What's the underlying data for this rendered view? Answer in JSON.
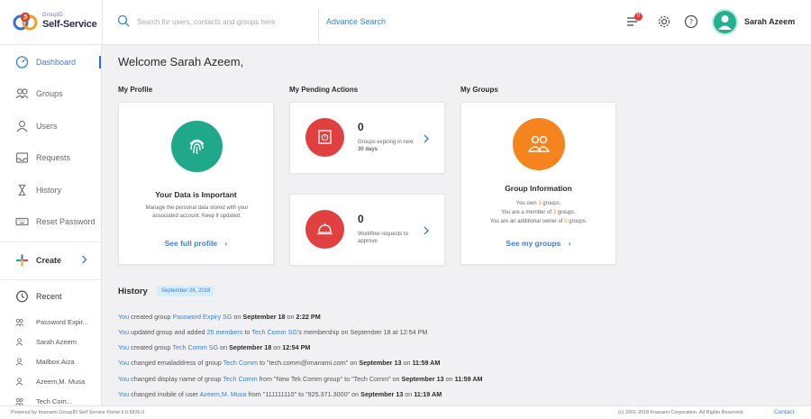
{
  "app": {
    "brand_small": "GroupID",
    "brand": "Self-Service"
  },
  "header": {
    "search_placeholder": "Search for users, contacts and groups here",
    "advance_search": "Advance Search",
    "notification_count": "0",
    "user_name": "Sarah Azeem"
  },
  "sidebar": {
    "items": [
      {
        "label": "Dashboard",
        "icon": "dashboard-icon"
      },
      {
        "label": "Groups",
        "icon": "groups-icon"
      },
      {
        "label": "Users",
        "icon": "user-icon"
      },
      {
        "label": "Requests",
        "icon": "inbox-icon"
      },
      {
        "label": "History",
        "icon": "hourglass-icon"
      },
      {
        "label": "Reset Password",
        "icon": "keyboard-icon"
      }
    ],
    "create_label": "Create",
    "recent_label": "Recent",
    "recent_items": [
      {
        "label": "Password Expir...",
        "icon": "group-icon"
      },
      {
        "label": "Sarah Azeem",
        "icon": "user-icon"
      },
      {
        "label": "Mailbox.Aiza",
        "icon": "user-icon"
      },
      {
        "label": "Azeem,M. Musa",
        "icon": "user-icon"
      },
      {
        "label": "Tech Com...",
        "icon": "group-icon"
      }
    ]
  },
  "main": {
    "welcome": "Welcome Sarah Azeem,",
    "profile": {
      "section_title": "My Profile",
      "title": "Your Data is Important",
      "desc": "Manage the personal data stored with your associated account. Keep it updated.",
      "link": "See full profile"
    },
    "pending": {
      "section_title": "My Pending Actions",
      "items": [
        {
          "count": "0",
          "text": "Groups expiring in next",
          "text_bold": "30 days"
        },
        {
          "count": "0",
          "text": "Workflow requests to approve",
          "text_bold": ""
        }
      ]
    },
    "groups": {
      "section_title": "My Groups",
      "title": "Group Information",
      "lines": [
        {
          "pre": "You own ",
          "num": "3",
          "post": " groups."
        },
        {
          "pre": "You are a member of ",
          "num": "3",
          "post": " groups."
        },
        {
          "pre": "You are an additional owner of ",
          "num": "0",
          "post": " groups."
        }
      ],
      "link": "See my groups"
    },
    "history": {
      "title": "History",
      "date": "September 26, 2018",
      "rows": [
        [
          {
            "t": "You",
            "c": "b"
          },
          {
            "t": " created group "
          },
          {
            "t": "Password Expiry SG",
            "c": "b"
          },
          {
            "t": " on "
          },
          {
            "t": "September 18",
            "c": "k"
          },
          {
            "t": " on "
          },
          {
            "t": "2:22 PM",
            "c": "k"
          }
        ],
        [
          {
            "t": "You",
            "c": "b"
          },
          {
            "t": " updated group and added "
          },
          {
            "t": "25 members",
            "c": "b"
          },
          {
            "t": " to "
          },
          {
            "t": "Tech Comm SG",
            "c": "b"
          },
          {
            "t": "'s membership on September 18 at 12:54 PM"
          }
        ],
        [
          {
            "t": "You",
            "c": "b"
          },
          {
            "t": " created group "
          },
          {
            "t": "Tech Comm SG",
            "c": "b"
          },
          {
            "t": " on "
          },
          {
            "t": "September 18",
            "c": "k"
          },
          {
            "t": " on "
          },
          {
            "t": "12:54 PM",
            "c": "k"
          }
        ],
        [
          {
            "t": "You",
            "c": "b"
          },
          {
            "t": " changed emailaddress of group "
          },
          {
            "t": "Tech Comm",
            "c": "b"
          },
          {
            "t": " to \"tech.comm@imanami.com\" on "
          },
          {
            "t": "September 13",
            "c": "k"
          },
          {
            "t": " on "
          },
          {
            "t": "11:59 AM",
            "c": "k"
          }
        ],
        [
          {
            "t": "You",
            "c": "b"
          },
          {
            "t": " changed display name of group "
          },
          {
            "t": "Tech Comm",
            "c": "b"
          },
          {
            "t": " from \"New Tek Comm group\" to \"Tech Comm\" on "
          },
          {
            "t": "September 13",
            "c": "k"
          },
          {
            "t": " on "
          },
          {
            "t": "11:59 AM",
            "c": "k"
          }
        ],
        [
          {
            "t": "You",
            "c": "b"
          },
          {
            "t": " changed mobile of user "
          },
          {
            "t": "Azeem,M. Musa",
            "c": "b"
          },
          {
            "t": " from \"111111110\" to \"925.371.3000\" on "
          },
          {
            "t": "September 13",
            "c": "k"
          },
          {
            "t": " on "
          },
          {
            "t": "11:19 AM",
            "c": "k"
          }
        ]
      ]
    }
  },
  "footer": {
    "left": "Powered by Imanami GroupID Self Service Portal 9.0.6836.0",
    "right": "(c) 2001-2018 Imanami Corporation. All Rights Reserved.",
    "contact": "Contact"
  },
  "colors": {
    "accent": "#3b7fd6",
    "profile_circle": "#1fa98a",
    "pending_circle": "#e04040",
    "groups_circle": "#f5841f"
  }
}
